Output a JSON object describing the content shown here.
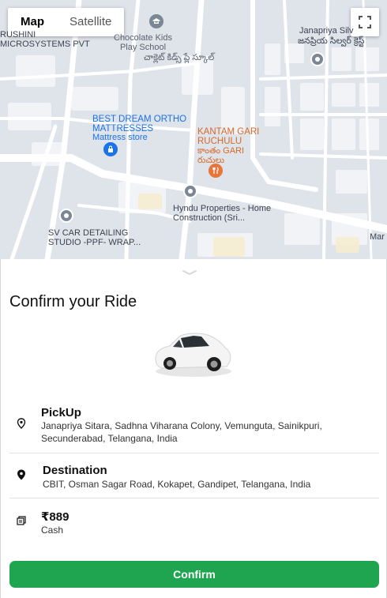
{
  "map": {
    "type_options": [
      "Map",
      "Satellite"
    ],
    "active_type": "Map",
    "labels": {
      "microsystems": "RUSHINI\nMICROSYSTEMS PVT",
      "school_name": "Chocolate Kids\nPlay School",
      "school_sub": "చాక్లెట్ కిడ్స్ ప్లే స్కూల్",
      "janapriya": "Janapriya Silv",
      "janapriya_sub": "జనప్రియ సిల్వర్ క్రెస్ట్",
      "mattress_name": "BEST DREAM ORTHO\nMATTRESSES",
      "mattress_sub": "Mattress store",
      "kantam_name": "KANTAM GARI\nRUCHULU",
      "kantam_sub": "కాంతం GARI\nరుచులు",
      "hyndu": "Hyndu Properties - Home\nConstruction (Sri...",
      "sv_car": "SV CAR DETAILING\nSTUDIO -PPF- WRAP...",
      "mar": "Mar"
    }
  },
  "ride": {
    "title": "Confirm your Ride",
    "pickup_label": "PickUp",
    "pickup_address": "Janapriya Sitara, Sadhna Viharana Colony, Vemunguta, Sainikpuri, Secunderabad, Telangana, India",
    "destination_label": "Destination",
    "destination_address": "CBIT, Osman Sagar Road, Kokapet, Gandipet, Telangana, India",
    "fare": "₹889",
    "payment_method": "Cash",
    "confirm_label": "Confirm"
  },
  "colors": {
    "confirm_green": "#1fa550",
    "map_road": "#ffffff",
    "map_block": "#f1f3f6",
    "map_bg": "#dfe3ea"
  }
}
